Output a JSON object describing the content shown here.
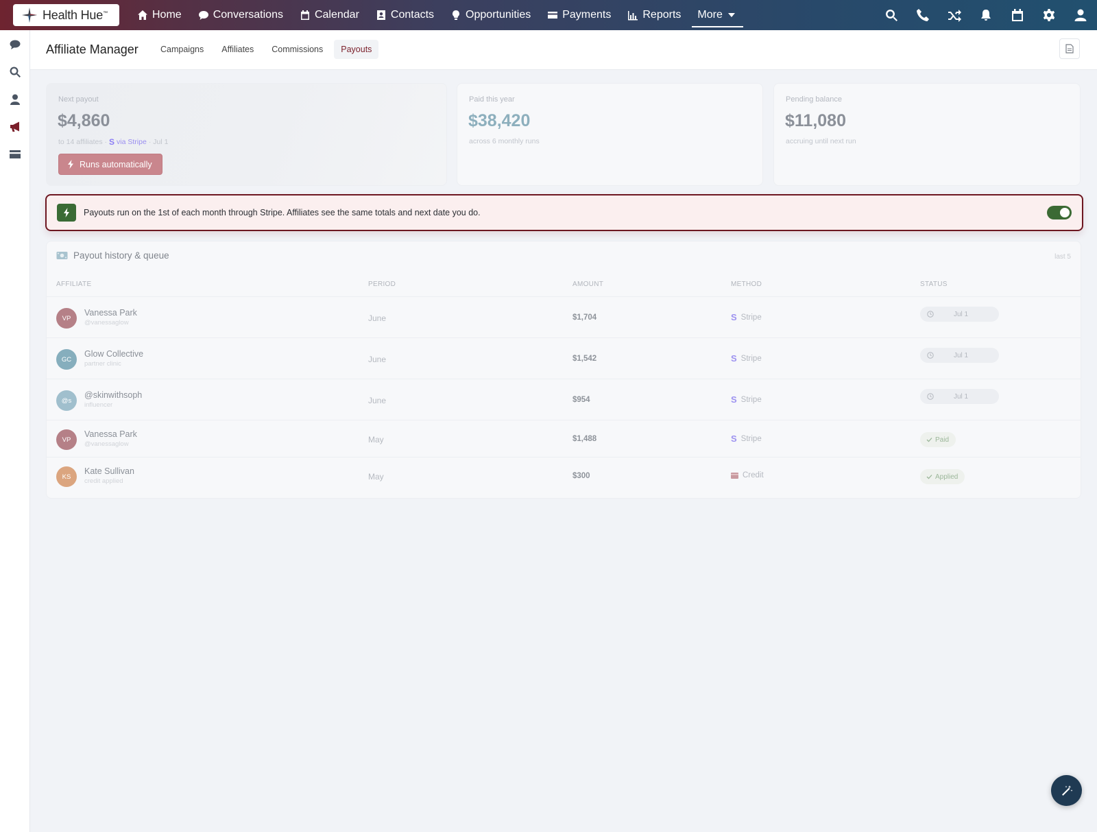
{
  "brand": {
    "name": "Health Hue",
    "mark": "™"
  },
  "nav": {
    "items": [
      {
        "label": "Home",
        "icon": "home-icon"
      },
      {
        "label": "Conversations",
        "icon": "chat-icon"
      },
      {
        "label": "Calendar",
        "icon": "calendar-icon"
      },
      {
        "label": "Contacts",
        "icon": "contacts-icon"
      },
      {
        "label": "Opportunities",
        "icon": "lightbulb-icon"
      },
      {
        "label": "Payments",
        "icon": "credit-card-icon"
      },
      {
        "label": "Reports",
        "icon": "bar-chart-icon"
      }
    ],
    "more_label": "More",
    "right_icons": [
      "search-icon",
      "phone-icon",
      "shuffle-icon",
      "bell-icon",
      "calendar-icon",
      "gear-icon",
      "user-icon"
    ]
  },
  "rail": {
    "icons": [
      "chat-icon",
      "search-icon",
      "user-icon",
      "megaphone-icon",
      "credit-card-icon"
    ]
  },
  "header": {
    "title": "Affiliate Manager",
    "tabs": [
      "Campaigns",
      "Affiliates",
      "Commissions",
      "Payouts"
    ],
    "active_tab": "Payouts"
  },
  "stats": {
    "next_payout": {
      "label": "Next payout",
      "value": "$4,860",
      "sub_prefix": "to 14 affiliates ·",
      "stripe_glyph": "S",
      "stripe_text": "via Stripe",
      "sub_suffix": "· Jul 1",
      "button_label": "Runs automatically"
    },
    "paid_year": {
      "label": "Paid this year",
      "value": "$38,420",
      "sub": "across 6 monthly runs"
    },
    "pending": {
      "label": "Pending balance",
      "value": "$11,080",
      "sub": "accruing until next run"
    }
  },
  "banner": {
    "text": "Payouts run on the 1st of each month through Stripe. Affiliates see the same totals and next date you do.",
    "toggle_on": true
  },
  "table": {
    "title": "Payout history & queue",
    "count_label": "last 5",
    "columns": [
      "AFFILIATE",
      "PERIOD",
      "AMOUNT",
      "METHOD",
      "STATUS"
    ],
    "rows": [
      {
        "initials": "VP",
        "avatar_color": "#b58087",
        "name": "Vanessa Park",
        "handle": "@vanessaglow",
        "period": "June",
        "amount": "$1,704",
        "method_glyph": "S",
        "method": "Stripe",
        "status": "Jul 1",
        "status_type": "queued"
      },
      {
        "initials": "GC",
        "avatar_color": "#86aebd",
        "name": "Glow Collective",
        "handle": "partner clinic",
        "period": "June",
        "amount": "$1,542",
        "method_glyph": "S",
        "method": "Stripe",
        "status": "Jul 1",
        "status_type": "queued"
      },
      {
        "initials": "@s",
        "avatar_color": "#a0bfcd",
        "name": "@skinwithsoph",
        "handle": "influencer",
        "period": "June",
        "amount": "$954",
        "method_glyph": "S",
        "method": "Stripe",
        "status": "Jul 1",
        "status_type": "queued"
      },
      {
        "initials": "VP",
        "avatar_color": "#b58087",
        "name": "Vanessa Park",
        "handle": "@vanessaglow",
        "period": "May",
        "amount": "$1,488",
        "method_glyph": "S",
        "method": "Stripe",
        "status": "Paid",
        "status_type": "done"
      },
      {
        "initials": "KS",
        "avatar_color": "#dba57f",
        "name": "Kate Sullivan",
        "handle": "credit applied",
        "period": "May",
        "amount": "$300",
        "method_glyph": "",
        "method": "Credit",
        "status": "Applied",
        "status_type": "done"
      }
    ]
  },
  "colors": {
    "accent": "#7a1f2a",
    "success": "#3b6a34",
    "stripe": "#8c7ef5",
    "fab": "#1f3a53"
  }
}
